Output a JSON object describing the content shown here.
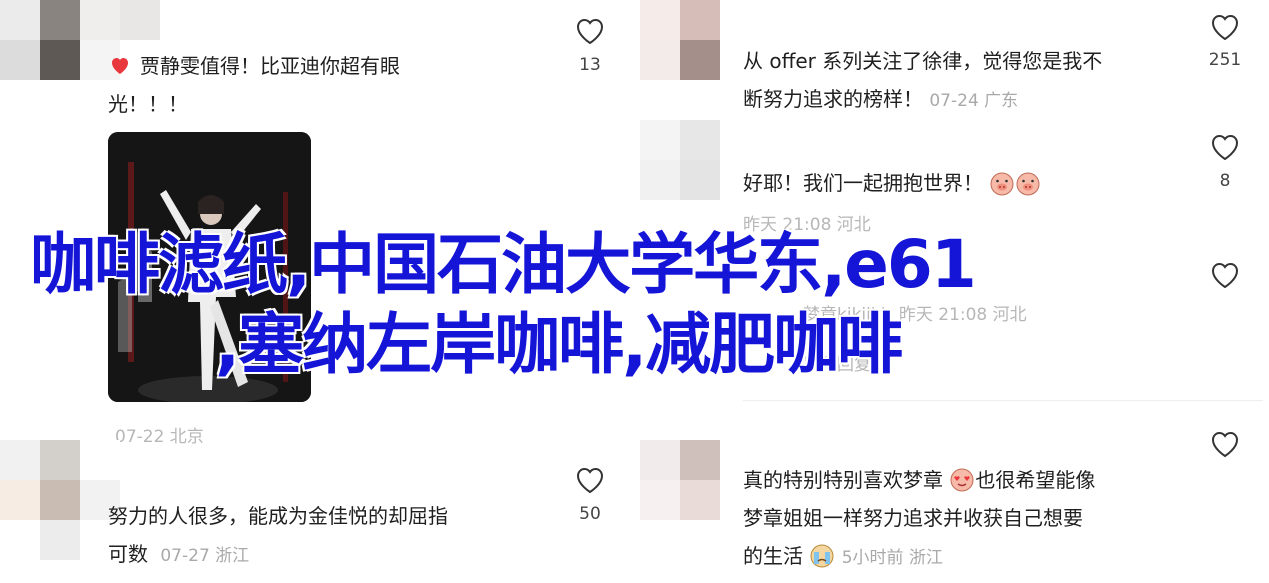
{
  "left": {
    "comments": [
      {
        "text_line1": "贾静雯值得！比亚迪你超有眼",
        "text_line2": "光！！！",
        "likes": "13"
      },
      {
        "meta": "07-22 北京"
      },
      {
        "text_line1": "努力的人很多，能成为金佳悦的却屈指",
        "text_line2": "可数",
        "meta": "07-27 浙江",
        "likes": "50"
      }
    ]
  },
  "right": {
    "comments": [
      {
        "text_line1": "从 offer 系列关注了徐律，觉得您是我不",
        "text_line2": "断努力追求的榜样！",
        "meta": "07-24 广东",
        "likes": "251"
      },
      {
        "text_line1": "好耶！我们一起拥抱世界！",
        "meta": "昨天 21:08 河北",
        "likes": "8"
      },
      {
        "partial_meta": "昨天 21:08 河北",
        "partial_author": "梦章kikiiki",
        "partial_reply": "展开回复"
      },
      {
        "text_line1": "真的特别特别喜欢梦章",
        "text_line1b": "也很希望能像",
        "text_line2": "梦章姐姐一样努力追求并收获自己想要",
        "text_line3": "的生活",
        "meta": "5小时前 浙江"
      }
    ]
  },
  "overlay": {
    "line1": "咖啡滤纸,中国石油大学华东,e61",
    "line2": ",塞纳左岸咖啡,减肥咖啡"
  },
  "colors": {
    "overlay_text": "#1515d8",
    "meta_text": "#a9a9a9",
    "heart_red": "#e8383d"
  }
}
